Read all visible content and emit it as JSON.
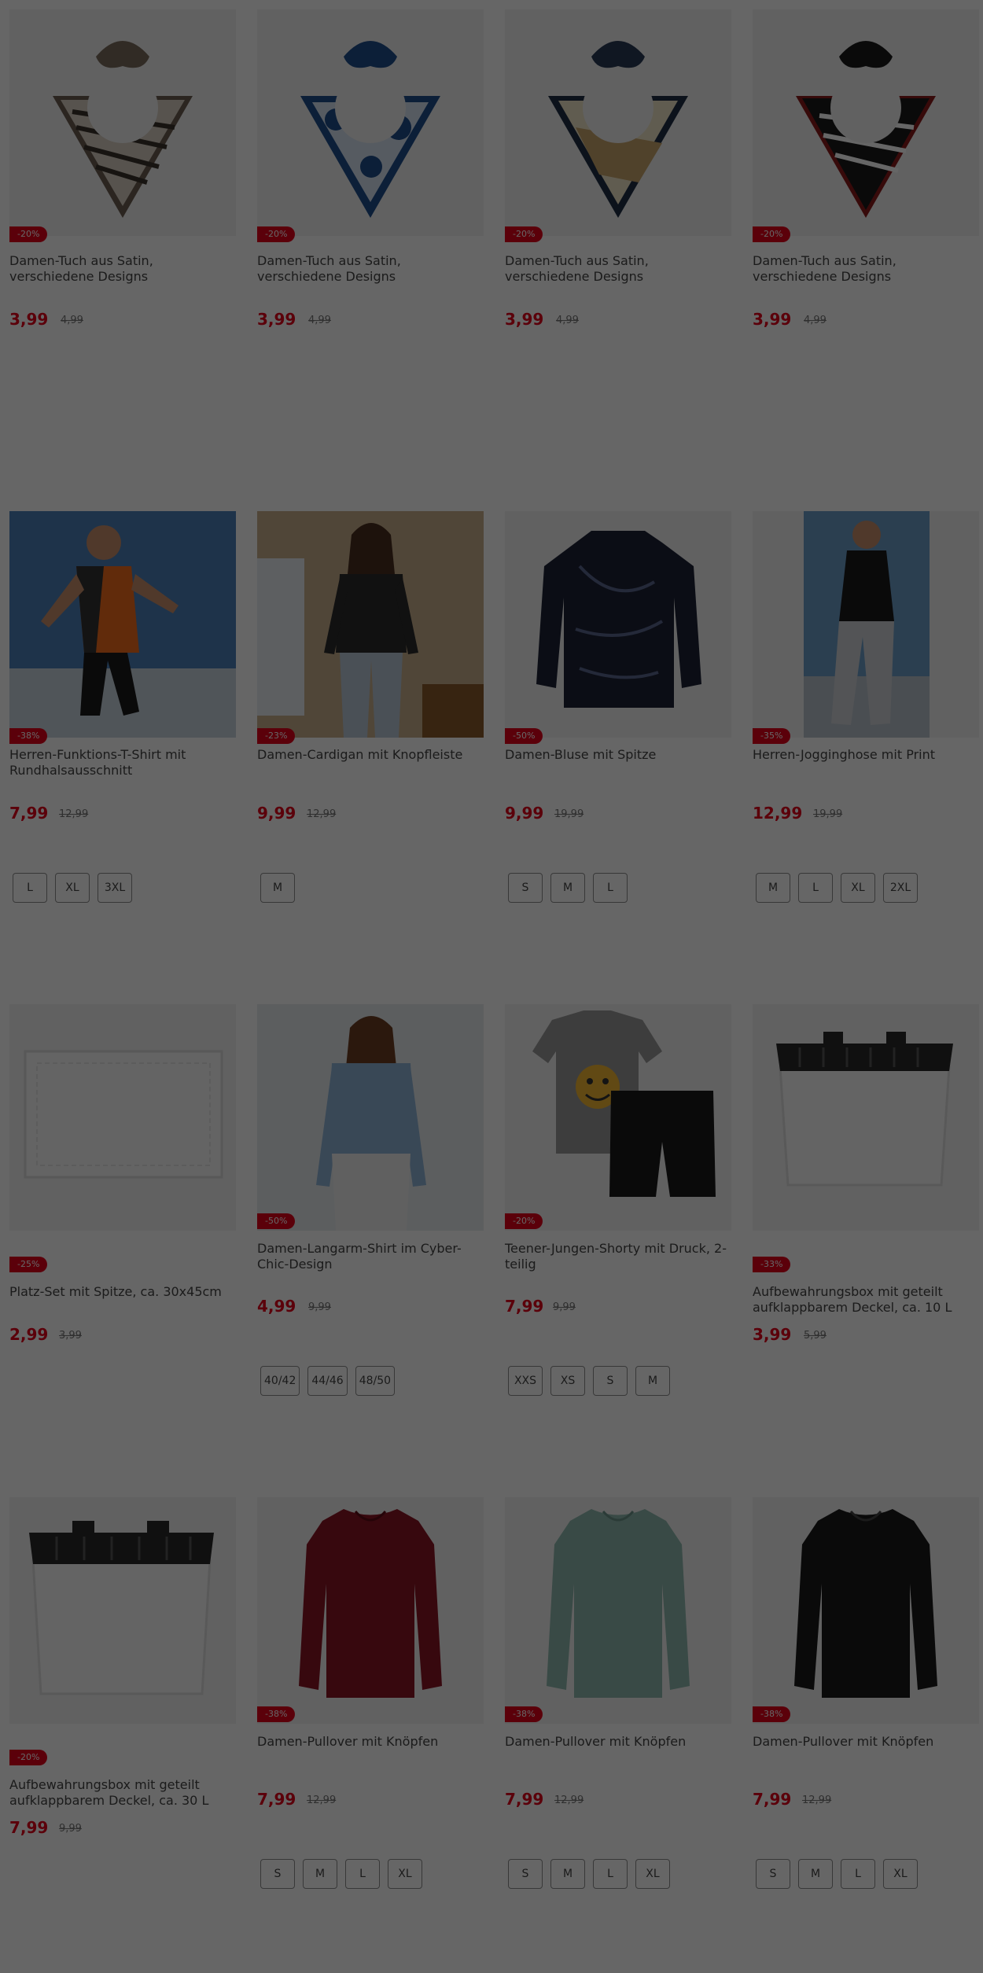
{
  "colors": {
    "accent": "#e3001b",
    "overlay": "rgba(0,0,0,0.60)"
  },
  "products": [
    {
      "title": "Damen-Tuch aus Satin, verschiedene Designs",
      "price": "3,99",
      "old": "4,99",
      "badge": "-20%",
      "sizes": [],
      "image": "scarf-beige"
    },
    {
      "title": "Damen-Tuch aus Satin, verschiedene Designs",
      "price": "3,99",
      "old": "4,99",
      "badge": "-20%",
      "sizes": [],
      "image": "scarf-blue"
    },
    {
      "title": "Damen-Tuch aus Satin, verschiedene Designs",
      "price": "3,99",
      "old": "4,99",
      "badge": "-20%",
      "sizes": [],
      "image": "scarf-cream"
    },
    {
      "title": "Damen-Tuch aus Satin, verschiedene Designs",
      "price": "3,99",
      "old": "4,99",
      "badge": "-20%",
      "sizes": [],
      "image": "scarf-black"
    },
    {
      "title": "Herren-Funktions-T-Shirt mit Rundhalsausschnitt",
      "price": "7,99",
      "old": "12,99",
      "badge": "-38%",
      "sizes": [
        "L",
        "XL",
        "3XL"
      ],
      "image": "runner-photo"
    },
    {
      "title": "Damen-Cardigan mit Knopfleiste",
      "price": "9,99",
      "old": "12,99",
      "badge": "-23%",
      "sizes": [
        "M"
      ],
      "image": "cardigan-photo"
    },
    {
      "title": "Damen-Bluse mit Spitze",
      "price": "9,99",
      "old": "19,99",
      "badge": "-50%",
      "sizes": [
        "S",
        "M",
        "L"
      ],
      "image": "blouse-dark"
    },
    {
      "title": "Herren-Jogginghose mit Print",
      "price": "12,99",
      "old": "19,99",
      "badge": "-35%",
      "sizes": [
        "M",
        "L",
        "XL",
        "2XL"
      ],
      "image": "jogger-photo"
    },
    {
      "title": "Platz-Set mit Spitze, ca. 30x45cm",
      "price": "2,99",
      "old": "3,99",
      "badge": "-25%",
      "sizes": [],
      "image": "placemat"
    },
    {
      "title": "Damen-Langarm-Shirt im Cyber-Chic-Design",
      "price": "4,99",
      "old": "9,99",
      "badge": "-50%",
      "sizes": [
        "40/42",
        "44/46",
        "48/50"
      ],
      "image": "longsleeve-photo"
    },
    {
      "title": "Teener-Jungen-Shorty mit Druck, 2-teilig",
      "price": "7,99",
      "old": "9,99",
      "badge": "-20%",
      "sizes": [
        "XXS",
        "XS",
        "S",
        "M"
      ],
      "image": "shorty"
    },
    {
      "title": "Aufbewahrungsbox mit geteilt aufklappbarem Deckel, ca. 10 L",
      "price": "3,99",
      "old": "5,99",
      "badge": "-33%",
      "sizes": [],
      "image": "box-small"
    },
    {
      "title": "Aufbewahrungsbox mit geteilt aufklappbarem Deckel, ca. 30 L",
      "price": "7,99",
      "old": "9,99",
      "badge": "-20%",
      "sizes": [],
      "image": "box-large"
    },
    {
      "title": "Damen-Pullover mit Knöpfen",
      "price": "7,99",
      "old": "12,99",
      "badge": "-38%",
      "sizes": [
        "S",
        "M",
        "L",
        "XL"
      ],
      "image": "pullover-red"
    },
    {
      "title": "Damen-Pullover mit Knöpfen",
      "price": "7,99",
      "old": "12,99",
      "badge": "-38%",
      "sizes": [
        "S",
        "M",
        "L",
        "XL"
      ],
      "image": "pullover-mint"
    },
    {
      "title": "Damen-Pullover mit Knöpfen",
      "price": "7,99",
      "old": "12,99",
      "badge": "-38%",
      "sizes": [
        "S",
        "M",
        "L",
        "XL"
      ],
      "image": "pullover-black"
    }
  ]
}
